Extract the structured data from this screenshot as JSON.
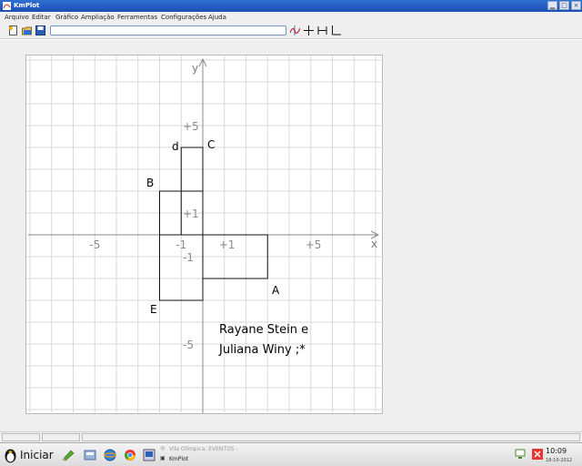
{
  "window": {
    "title": "KmPlot"
  },
  "menu": [
    "Arquivo",
    "Editar",
    "Gráfico",
    "Ampliação",
    "Ferramentas",
    "Configurações",
    "Ajuda"
  ],
  "toolbar": {
    "function_input_value": "",
    "icons": [
      "new-file-icon",
      "open-file-icon",
      "save-file-icon",
      "plot-function-icon",
      "crosshair-icon",
      "axes-mode-icon",
      "axes-l-icon"
    ]
  },
  "plot": {
    "axis_x_label": "x",
    "axis_y_label": "y",
    "x_ticks": [
      "-5",
      "-1",
      "+1",
      "+5"
    ],
    "y_ticks": [
      "+5",
      "+1",
      "-1",
      "-5"
    ],
    "point_labels": {
      "A": "A",
      "B": "B",
      "C": "C",
      "d": "d",
      "E": "E"
    },
    "note_line1": "Rayane Stein e",
    "note_line2": "Juliana Winy ;*"
  },
  "chart_data": {
    "type": "diagram",
    "x_range": [
      -8,
      8
    ],
    "y_range": [
      -8,
      8
    ],
    "grid": true,
    "rectangles": [
      {
        "label": "d–C",
        "x": [
          -1,
          0
        ],
        "y": [
          0,
          4
        ]
      },
      {
        "label": "B",
        "x": [
          -2,
          0
        ],
        "y": [
          0,
          2
        ]
      },
      {
        "label": "A",
        "x": [
          0,
          3
        ],
        "y": [
          -2,
          0
        ]
      },
      {
        "label": "E",
        "x": [
          -2,
          0
        ],
        "y": [
          -3,
          0
        ]
      }
    ]
  },
  "taskbar": {
    "start_label": "Iniciar",
    "tasks": [
      "Vila Olímpica: EVENTOS - ",
      "KmPlot"
    ],
    "clock": "10:09",
    "date": "18-10-2012"
  },
  "colors": {
    "titlebar": "#2f6fd1",
    "grid": "#d9d9d9",
    "axes": "#8a8a8a",
    "shapes": "#111111"
  }
}
